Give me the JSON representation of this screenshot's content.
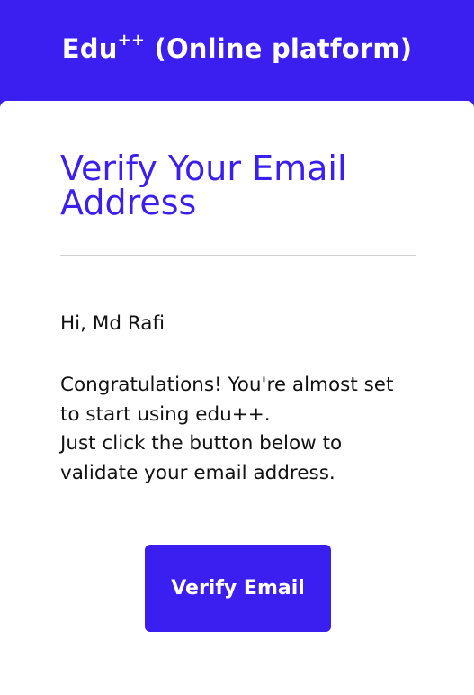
{
  "header": {
    "brand_name": "Edu",
    "brand_superscript": "++",
    "brand_suffix": " (Online platform)"
  },
  "email": {
    "title": "Verify Your Email Address",
    "greeting": "Hi, Md Rafi",
    "message_lines": [
      "Congratulations! You're almost set",
      "to start using edu++.",
      "Just click the button below to",
      "validate your email address."
    ],
    "button_label": "Verify Email"
  },
  "colors": {
    "brand": "#3a1ff0",
    "card_background": "#ffffff",
    "body_text": "#111111",
    "divider": "#d0d0d0"
  }
}
